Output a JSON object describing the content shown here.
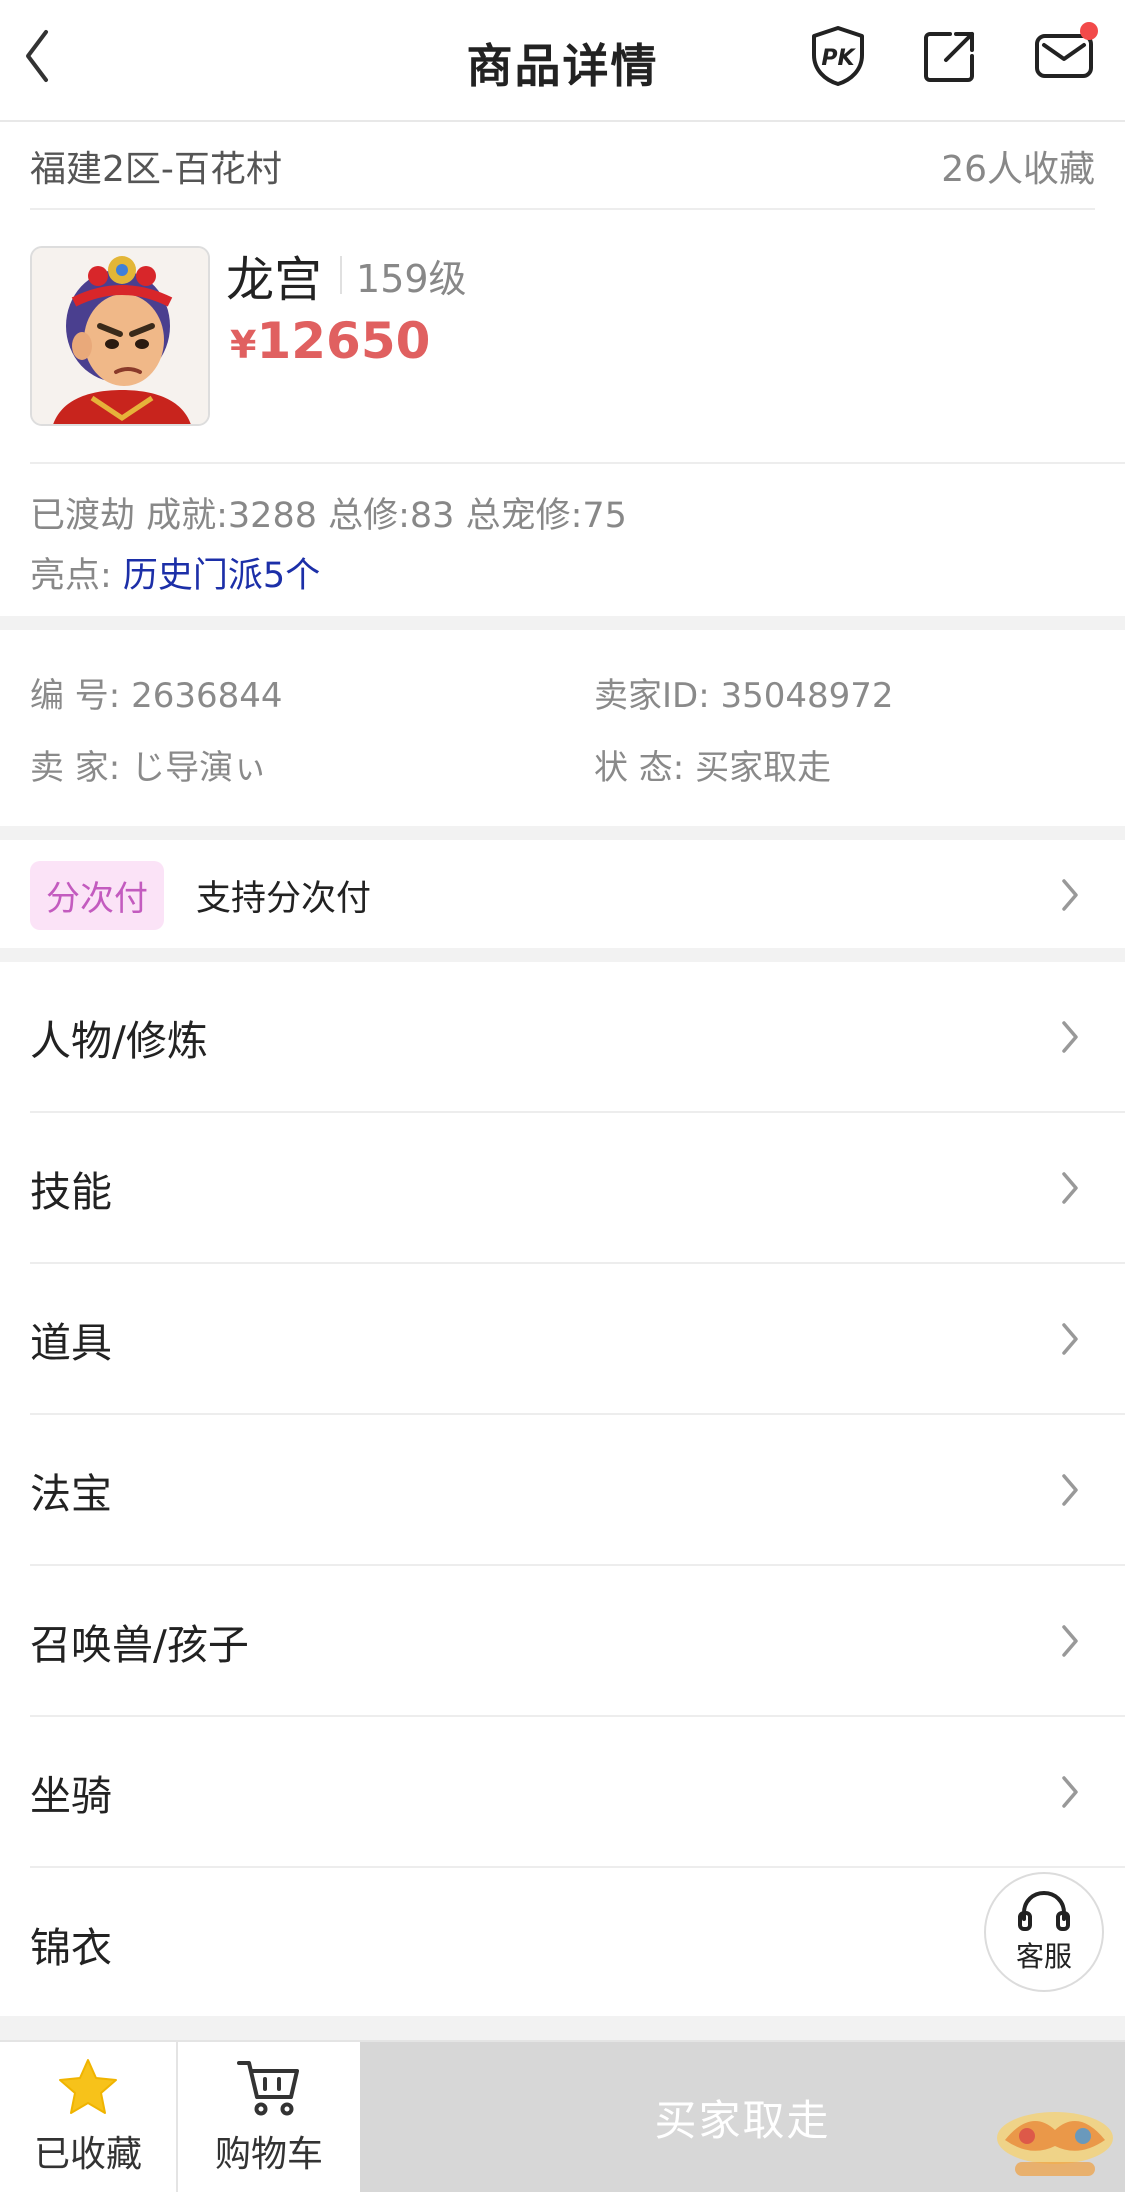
{
  "header": {
    "title": "商品详情"
  },
  "server": {
    "name": "福建2区-百花村",
    "favorites": "26人收藏"
  },
  "product": {
    "name": "龙宫",
    "level": "159级",
    "currency": "¥",
    "price": "12650"
  },
  "attributes": {
    "line1": "已渡劫 成就:3288 总修:83 总宠修:75",
    "highlight_label": "亮点: ",
    "highlight_value": "历史门派5个"
  },
  "info": {
    "id_label": "编 号:",
    "id_value": "2636844",
    "seller_id_label": "卖家ID:",
    "seller_id_value": "35048972",
    "seller_label": "卖 家:",
    "seller_value": "じ导演ぃ",
    "status_label": "状 态:",
    "status_value": "买家取走"
  },
  "installment": {
    "badge": "分次付",
    "text": "支持分次付"
  },
  "menu": [
    {
      "label": "人物/修炼"
    },
    {
      "label": "技能"
    },
    {
      "label": "道具"
    },
    {
      "label": "法宝"
    },
    {
      "label": "召唤兽/孩子"
    },
    {
      "label": "坐骑"
    },
    {
      "label": "锦衣"
    }
  ],
  "service": {
    "label": "客服"
  },
  "bottom": {
    "favorite_label": "已收藏",
    "cart_label": "购物车",
    "buy_label": "买家取走"
  },
  "colors": {
    "price": "#e06060",
    "highlight": "#1c2fa8",
    "badge_bg": "#fbe3f7",
    "badge_text": "#c35bbf",
    "notify_dot": "#f24a4a",
    "star": "#f7c21a",
    "buy_disabled_bg": "#d7d7d7"
  },
  "icons": {
    "back": "chevron-left-icon",
    "pk": "pk-shield-icon",
    "share": "share-icon",
    "mail": "mail-icon",
    "chevron": "chevron-right-icon",
    "headset": "headset-icon",
    "star": "star-icon",
    "cart": "cart-icon"
  }
}
